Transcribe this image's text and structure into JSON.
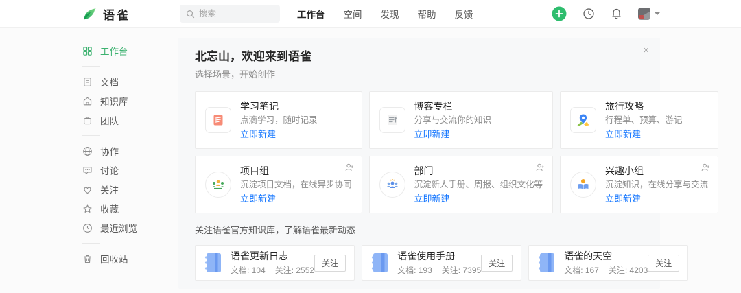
{
  "header": {
    "logo_text": "语雀",
    "search_placeholder": "搜索",
    "nav": [
      {
        "label": "工作台",
        "active": true
      },
      {
        "label": "空间"
      },
      {
        "label": "发现"
      },
      {
        "label": "帮助"
      },
      {
        "label": "反馈"
      }
    ],
    "right_icons": [
      "plus-circle",
      "clock",
      "bell",
      "avatar",
      "caret-down"
    ]
  },
  "sidebar": {
    "items": [
      {
        "label": "工作台",
        "icon": "grid",
        "active": true
      },
      {
        "label": "文档",
        "icon": "document"
      },
      {
        "label": "知识库",
        "icon": "book-home"
      },
      {
        "label": "团队",
        "icon": "team-bag"
      },
      {
        "label": "协作",
        "icon": "globe"
      },
      {
        "label": "讨论",
        "icon": "comment"
      },
      {
        "label": "关注",
        "icon": "heart"
      },
      {
        "label": "收藏",
        "icon": "star"
      },
      {
        "label": "最近浏览",
        "icon": "clock"
      },
      {
        "label": "回收站",
        "icon": "trash"
      }
    ]
  },
  "main": {
    "close_icon": "×",
    "welcome_title": "北忘山，欢迎来到语雀",
    "welcome_subtitle": "选择场景，开始创作",
    "scenario_cards": [
      {
        "title": "学习笔记",
        "desc": "点滴学习，随时记录",
        "action": "立即新建",
        "icon": "red-notebook"
      },
      {
        "title": "博客专栏",
        "desc": "分享与交流你的知识",
        "action": "立即新建",
        "icon": "gray-article"
      },
      {
        "title": "旅行攻略",
        "desc": "行程单、预算、游记",
        "action": "立即新建",
        "icon": "map-pin"
      },
      {
        "title": "项目组",
        "desc": "沉淀项目文档，在线异步协同",
        "action": "立即新建",
        "icon": "org-people",
        "corner_icon": "add-member"
      },
      {
        "title": "部门",
        "desc": "沉淀新人手册、周报、组织文化等",
        "action": "立即新建",
        "icon": "department-people",
        "corner_icon": "add-member"
      },
      {
        "title": "兴趣小组",
        "desc": "沉淀知识，在线分享与交流",
        "action": "立即新建",
        "icon": "reader-person",
        "corner_icon": "add-member"
      }
    ],
    "follow_section_title": "关注语雀官方知识库，了解语雀最新动态",
    "follow_cards": [
      {
        "title": "语雀更新日志",
        "button": "关注",
        "docs": "文档: 104",
        "followers": "关注: 2552",
        "icon": "blue-notebook"
      },
      {
        "title": "语雀使用手册",
        "button": "关注",
        "docs": "文档: 193",
        "followers": "关注: 7395",
        "icon": "blue-notebook"
      },
      {
        "title": "语雀的天空",
        "button": "关注",
        "docs": "文档: 167",
        "followers": "关注: 4203",
        "icon": "blue-notebook"
      }
    ]
  },
  "colors": {
    "brand_green": "#3db270",
    "plus_button_green": "#2ebd6e",
    "link_blue": "#1677ff",
    "panel_bg": "#f7f8f9",
    "page_bg": "#fbfbfb"
  }
}
